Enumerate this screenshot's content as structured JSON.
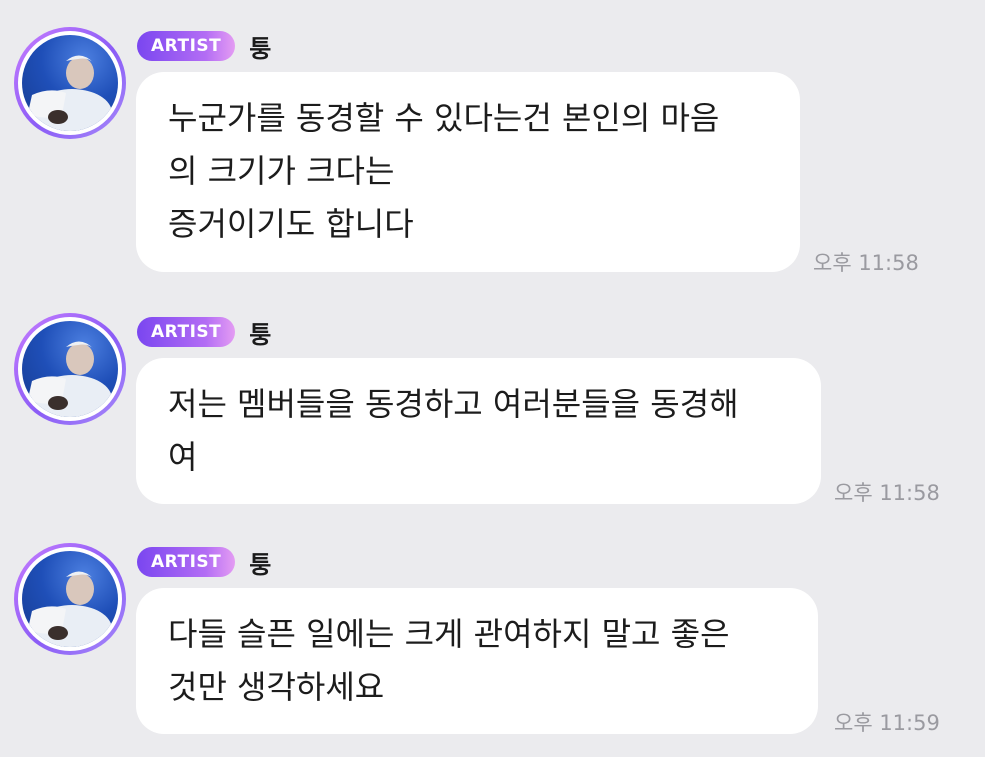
{
  "messages": [
    {
      "badge": "ARTIST",
      "name": "퉁",
      "lines": [
        "누군가를 동경할 수 있다는건 본인의 마음",
        "의 크기가 크다는",
        "증거이기도 합니다"
      ],
      "time": "오후 11:58"
    },
    {
      "badge": "ARTIST",
      "name": "퉁",
      "lines": [
        "저는 멤버들을 동경하고 여러분들을 동경해",
        "여"
      ],
      "time": "오후 11:58"
    },
    {
      "badge": "ARTIST",
      "name": "퉁",
      "lines": [
        "다들 슬픈 일에는 크게 관여하지 말고 좋은",
        "것만 생각하세요"
      ],
      "time": "오후 11:59"
    }
  ],
  "colors": {
    "background": "#ebebee",
    "bubble": "#ffffff",
    "badge_start": "#7a46f0",
    "badge_end": "#e49cf3",
    "time_text": "#9a9aa0"
  },
  "icons": {
    "avatar": "profile-photo"
  }
}
